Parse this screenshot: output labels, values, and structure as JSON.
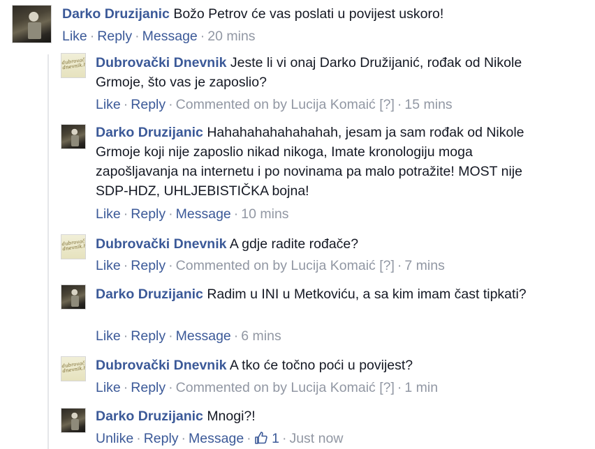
{
  "comments": [
    {
      "author": "Darko Druzijanic",
      "text": "Božo Petrov će vas poslati u povijest uskoro!",
      "actions": [
        "Like",
        "Reply",
        "Message"
      ],
      "time": "20 mins",
      "avatar": "darko"
    },
    {
      "author": "Dubrovački Dnevnik",
      "text": "Jeste li vi onaj Darko Družijanić, rođak od Nikole Grmoje, što vas je zaposlio?",
      "actions": [
        "Like",
        "Reply"
      ],
      "commented_on_by": "Commented on by Lucija Komaić",
      "info": "[?]",
      "time": "15 mins",
      "avatar": "dnevnik"
    },
    {
      "author": "Darko Druzijanic",
      "text": "Hahahahahahahahah, jesam ja sam rođak od Nikole Grmoje koji nije zaposlio nikad nikoga, Imate kronologiju moga zapošljavanja na internetu i po novinama pa malo potražite! MOST nije SDP-HDZ, UHLJEBISTIČKA bojna!",
      "actions": [
        "Like",
        "Reply",
        "Message"
      ],
      "time": "10 mins",
      "avatar": "darko"
    },
    {
      "author": "Dubrovački Dnevnik",
      "text": "A gdje radite rođače?",
      "actions": [
        "Like",
        "Reply"
      ],
      "commented_on_by": "Commented on by Lucija Komaić",
      "info": "[?]",
      "time": "7 mins",
      "avatar": "dnevnik"
    },
    {
      "author": "Darko Druzijanic",
      "text": "Radim u INI u Metkoviću, a sa kim imam čast tipkati?",
      "actions": [
        "Like",
        "Reply",
        "Message"
      ],
      "time": "6 mins",
      "avatar": "darko"
    },
    {
      "author": "Dubrovački Dnevnik",
      "text": "A tko će točno poći u povijest?",
      "actions": [
        "Like",
        "Reply"
      ],
      "commented_on_by": "Commented on by Lucija Komaić",
      "info": "[?]",
      "time": "1 min",
      "avatar": "dnevnik"
    },
    {
      "author": "Darko Druzijanic",
      "text": "Mnogi?!",
      "actions": [
        "Unlike",
        "Reply",
        "Message"
      ],
      "like_count": "1",
      "time": "Just now",
      "avatar": "darko"
    }
  ],
  "dnevnik_logo_text": "dubrovački dnevnik.hr",
  "colors": {
    "link": "#3b5998",
    "meta": "#9197a3",
    "text": "#141823"
  }
}
